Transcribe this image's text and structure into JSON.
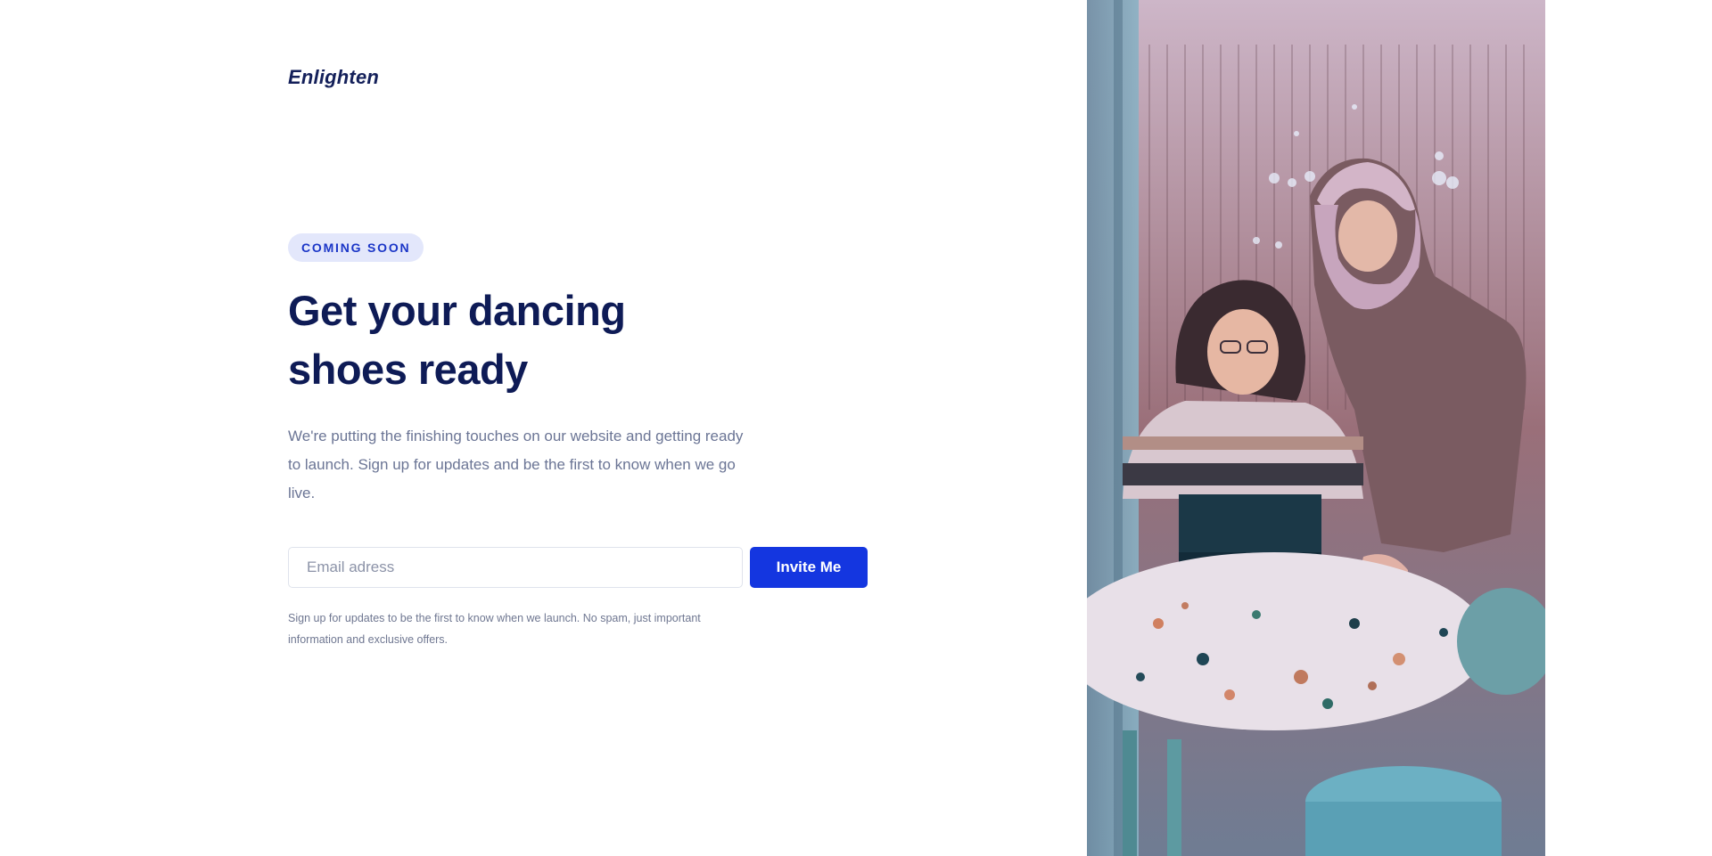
{
  "brand": {
    "logo_text": "Enlighten"
  },
  "hero": {
    "badge": "COMING SOON",
    "headline": "Get your dancing shoes ready",
    "description": "We're putting the finishing touches on our website and getting ready to launch. Sign up for updates and be the first to know when we go live."
  },
  "signup": {
    "email_placeholder": "Email adress",
    "email_value": "",
    "button_label": "Invite Me",
    "fineprint": "Sign up for updates to be the first to know when we launch. No spam, just important information and exclusive offers."
  },
  "colors": {
    "primary": "#1436e0",
    "heading": "#0e1b56",
    "badge_bg": "#e3e7fb",
    "body_text": "#6b7595"
  },
  "icons": {
    "photo": "two-women-laptop-photo",
    "laptop_logo": "windows-logo-icon"
  }
}
